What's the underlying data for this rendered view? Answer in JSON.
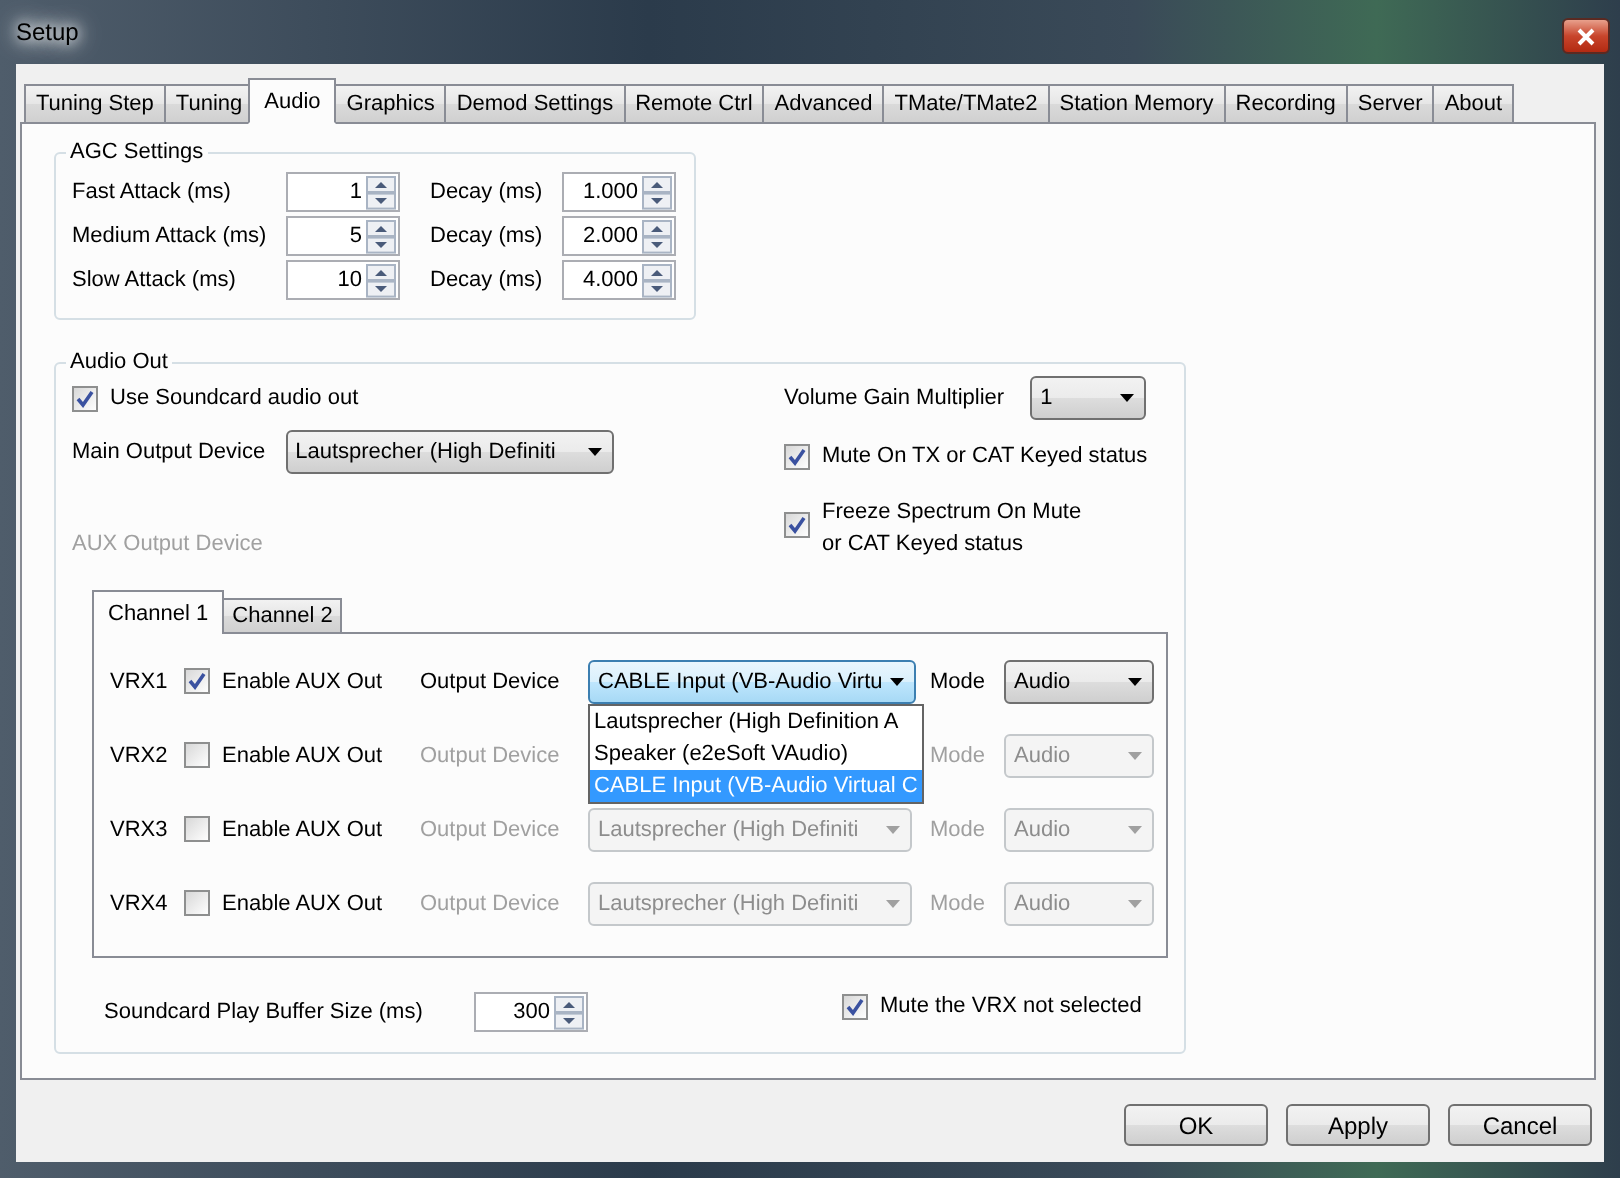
{
  "window": {
    "title": "Setup"
  },
  "tabs": [
    {
      "label": "Tuning Step",
      "selected": false
    },
    {
      "label": "Tuning",
      "selected": false
    },
    {
      "label": "Audio",
      "selected": true
    },
    {
      "label": "Graphics",
      "selected": false
    },
    {
      "label": "Demod Settings",
      "selected": false
    },
    {
      "label": "Remote Ctrl",
      "selected": false
    },
    {
      "label": "Advanced",
      "selected": false
    },
    {
      "label": "TMate/TMate2",
      "selected": false
    },
    {
      "label": "Station Memory",
      "selected": false
    },
    {
      "label": "Recording",
      "selected": false
    },
    {
      "label": "Server",
      "selected": false
    },
    {
      "label": "About",
      "selected": false
    }
  ],
  "agc": {
    "title": "AGC Settings",
    "rows": [
      {
        "label": "Fast Attack (ms)",
        "value": "1",
        "decay_label": "Decay (ms)",
        "decay_value": "1.000"
      },
      {
        "label": "Medium Attack (ms)",
        "value": "5",
        "decay_label": "Decay (ms)",
        "decay_value": "2.000"
      },
      {
        "label": "Slow Attack (ms)",
        "value": "10",
        "decay_label": "Decay (ms)",
        "decay_value": "4.000"
      }
    ]
  },
  "audio_out": {
    "title": "Audio Out",
    "use_soundcard": {
      "label": "Use Soundcard audio out",
      "checked": true
    },
    "main_output": {
      "label": "Main Output Device",
      "value": "Lautsprecher (High Definiti"
    },
    "volume_gain": {
      "label": "Volume Gain Multiplier",
      "value": "1"
    },
    "mute_on_tx": {
      "label": "Mute On TX or CAT Keyed status",
      "checked": true
    },
    "freeze_spectrum": {
      "label": "Freeze Spectrum On Mute or CAT Keyed status",
      "checked": true
    },
    "aux_output_device": {
      "label": "AUX Output Device",
      "disabled": true
    },
    "channel_tabs": [
      {
        "label": "Channel 1",
        "selected": true
      },
      {
        "label": "Channel 2",
        "selected": false
      }
    ],
    "vrx_rows": [
      {
        "name": "VRX1",
        "enable_label": "Enable AUX Out",
        "checked": true,
        "device_label": "Output Device",
        "device": "CABLE Input (VB-Audio Virtu",
        "open": true,
        "device_options": [
          {
            "label": "Lautsprecher (High Definition A",
            "selected": false
          },
          {
            "label": "Speaker (e2eSoft VAudio)",
            "selected": false
          },
          {
            "label": "CABLE Input (VB-Audio Virtual C",
            "selected": true
          }
        ],
        "mode_label": "Mode",
        "mode": "Audio"
      },
      {
        "name": "VRX2",
        "enable_label": "Enable AUX Out",
        "checked": false,
        "device_label": "Output Device",
        "open": false,
        "mode_label": "Mode",
        "mode": "Audio"
      },
      {
        "name": "VRX3",
        "enable_label": "Enable AUX Out",
        "checked": false,
        "device_label": "Output Device",
        "device": "Lautsprecher (High Definiti",
        "open": false,
        "mode_label": "Mode",
        "mode": "Audio"
      },
      {
        "name": "VRX4",
        "enable_label": "Enable AUX Out",
        "checked": false,
        "device_label": "Output Device",
        "device": "Lautsprecher (High Definiti",
        "open": false,
        "mode_label": "Mode",
        "mode": "Audio"
      }
    ],
    "buffer_size": {
      "label": "Soundcard Play Buffer Size (ms)",
      "value": "300"
    },
    "mute_unselected": {
      "label": "Mute the VRX not selected",
      "checked": true
    }
  },
  "buttons": [
    "OK",
    "Apply",
    "Cancel"
  ]
}
